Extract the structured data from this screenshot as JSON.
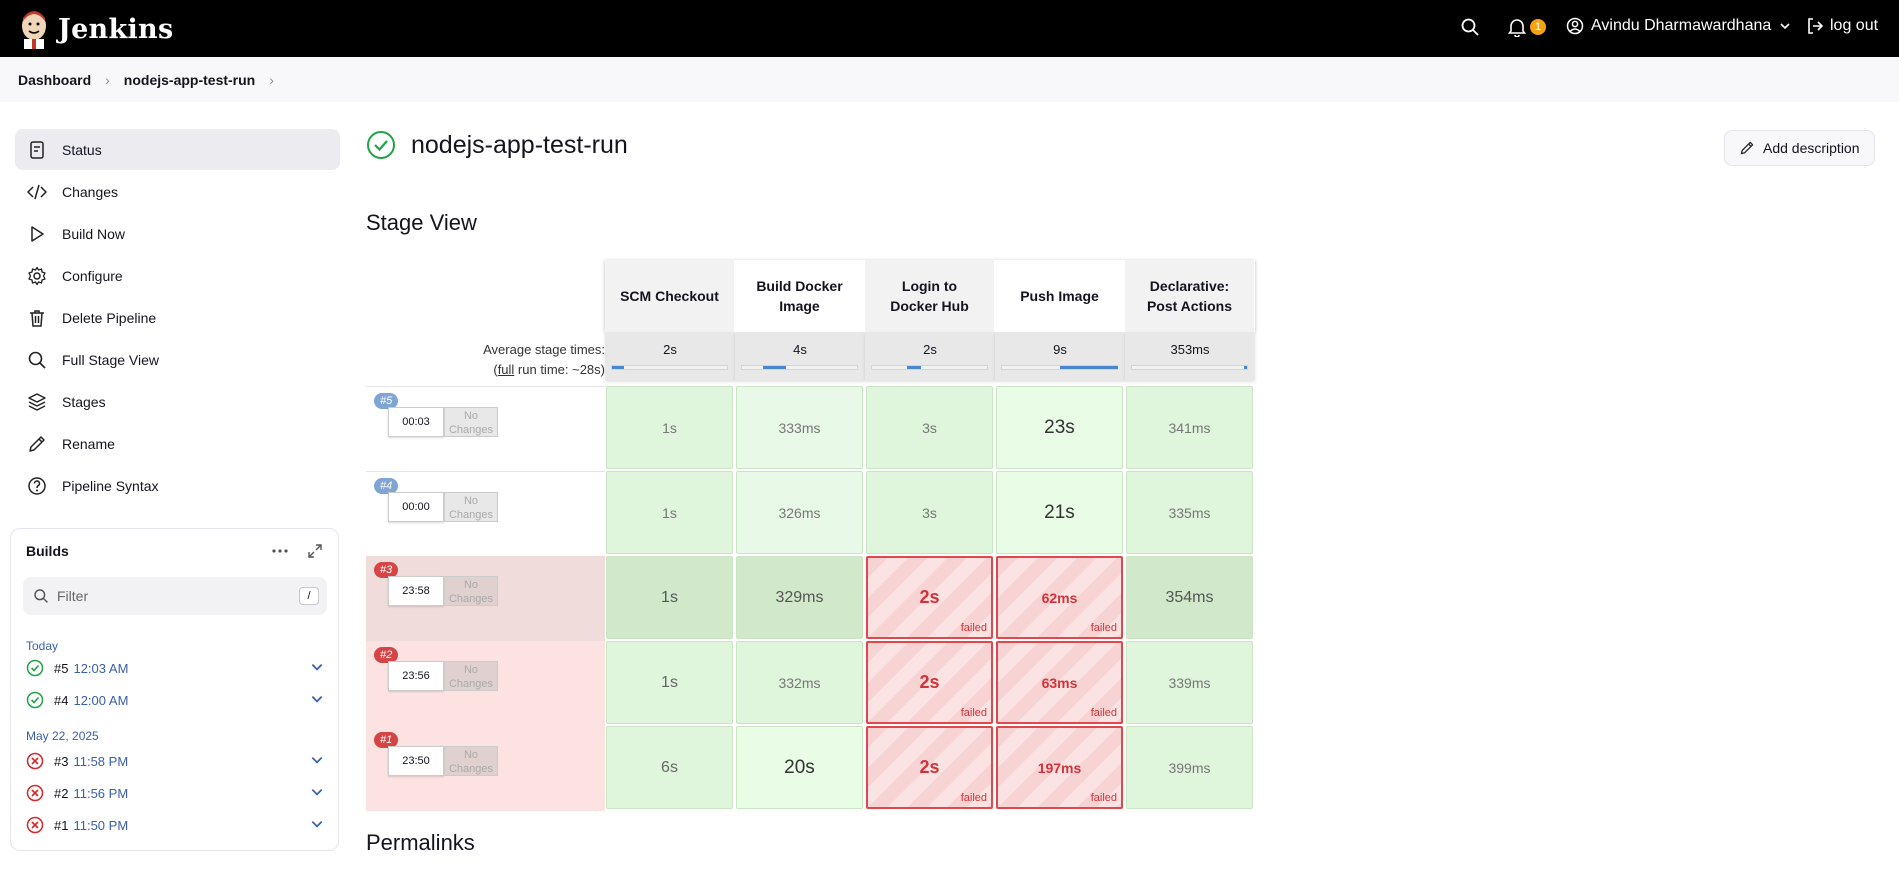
{
  "header": {
    "brand": "Jenkins",
    "notifications_count": "1",
    "user_name": "Avindu Dharmawardhana",
    "logout_label": "log out"
  },
  "breadcrumbs": [
    "Dashboard",
    "nodejs-app-test-run"
  ],
  "sidebar": {
    "items": [
      {
        "label": "Status",
        "icon": "document-icon",
        "active": true
      },
      {
        "label": "Changes",
        "icon": "code-icon"
      },
      {
        "label": "Build Now",
        "icon": "play-icon"
      },
      {
        "label": "Configure",
        "icon": "gear-icon"
      },
      {
        "label": "Delete Pipeline",
        "icon": "trash-icon"
      },
      {
        "label": "Full Stage View",
        "icon": "search-icon"
      },
      {
        "label": "Stages",
        "icon": "layers-icon"
      },
      {
        "label": "Rename",
        "icon": "pencil-icon"
      },
      {
        "label": "Pipeline Syntax",
        "icon": "help-icon"
      }
    ]
  },
  "builds_panel": {
    "title": "Builds",
    "filter_placeholder": "Filter",
    "filter_shortcut": "/",
    "groups": [
      {
        "label": "Today",
        "builds": [
          {
            "number": "#5",
            "time": "12:03 AM",
            "status": "success"
          },
          {
            "number": "#4",
            "time": "12:00 AM",
            "status": "success"
          }
        ]
      },
      {
        "label": "May 22, 2025",
        "builds": [
          {
            "number": "#3",
            "time": "11:58 PM",
            "status": "failed"
          },
          {
            "number": "#2",
            "time": "11:56 PM",
            "status": "failed"
          },
          {
            "number": "#1",
            "time": "11:50 PM",
            "status": "failed"
          }
        ]
      }
    ]
  },
  "main": {
    "job_title": "nodejs-app-test-run",
    "add_description_label": "Add description",
    "stage_view_title": "Stage View",
    "permalinks_title": "Permalinks"
  },
  "stage_view": {
    "avg_label_line1": "Average stage times:",
    "avg_label_prefix": "(",
    "avg_label_link": "full",
    "avg_label_suffix": " run time: ~28s)",
    "stages": [
      {
        "name_line1": "SCM Checkout",
        "name_line2": "",
        "avg": "2s",
        "avg_fill_start": 0.0,
        "avg_fill_end": 0.1
      },
      {
        "name_line1": "Build Docker",
        "name_line2": "Image",
        "avg": "4s",
        "avg_fill_start": 0.18,
        "avg_fill_end": 0.38
      },
      {
        "name_line1": "Login to",
        "name_line2": "Docker Hub",
        "avg": "2s",
        "avg_fill_start": 0.3,
        "avg_fill_end": 0.42
      },
      {
        "name_line1": "Push Image",
        "name_line2": "",
        "avg": "9s",
        "avg_fill_start": 0.5,
        "avg_fill_end": 1.0
      },
      {
        "name_line1": "Declarative:",
        "name_line2": "Post Actions",
        "avg": "353ms",
        "avg_fill_start": 0.97,
        "avg_fill_end": 1.0
      }
    ],
    "runs": [
      {
        "badge": "#5",
        "status": "ok",
        "time": "00:03",
        "changes_line1": "No",
        "changes_line2": "Changes",
        "cells": [
          {
            "v": "1s"
          },
          {
            "v": "333ms",
            "style": "light"
          },
          {
            "v": "3s"
          },
          {
            "v": "23s",
            "style": "hl"
          },
          {
            "v": "341ms"
          }
        ]
      },
      {
        "badge": "#4",
        "status": "ok",
        "time": "00:00",
        "changes_line1": "No",
        "changes_line2": "Changes",
        "cells": [
          {
            "v": "1s"
          },
          {
            "v": "326ms",
            "style": "light"
          },
          {
            "v": "3s"
          },
          {
            "v": "21s",
            "style": "hl"
          },
          {
            "v": "335ms"
          }
        ]
      },
      {
        "badge": "#3",
        "status": "bad",
        "selected": true,
        "time": "23:58",
        "changes_line1": "No",
        "changes_line2": "Changes",
        "cells": [
          {
            "v": "1s",
            "style": "sel"
          },
          {
            "v": "329ms",
            "style": "sel"
          },
          {
            "v": "2s",
            "fail": true
          },
          {
            "v": "62ms",
            "fail": true,
            "small": true
          },
          {
            "v": "354ms",
            "style": "sel"
          }
        ]
      },
      {
        "badge": "#2",
        "status": "bad",
        "time": "23:56",
        "changes_line1": "No",
        "changes_line2": "Changes",
        "cells": [
          {
            "v": "1s",
            "style": "big"
          },
          {
            "v": "332ms"
          },
          {
            "v": "2s",
            "fail": true
          },
          {
            "v": "63ms",
            "fail": true,
            "small": true
          },
          {
            "v": "339ms"
          }
        ]
      },
      {
        "badge": "#1",
        "status": "bad",
        "time": "23:50",
        "changes_line1": "No",
        "changes_line2": "Changes",
        "cells": [
          {
            "v": "6s",
            "style": "big"
          },
          {
            "v": "20s",
            "style": "hl"
          },
          {
            "v": "2s",
            "fail": true
          },
          {
            "v": "197ms",
            "fail": true,
            "small": true
          },
          {
            "v": "399ms"
          }
        ]
      }
    ],
    "failed_label": "failed"
  }
}
